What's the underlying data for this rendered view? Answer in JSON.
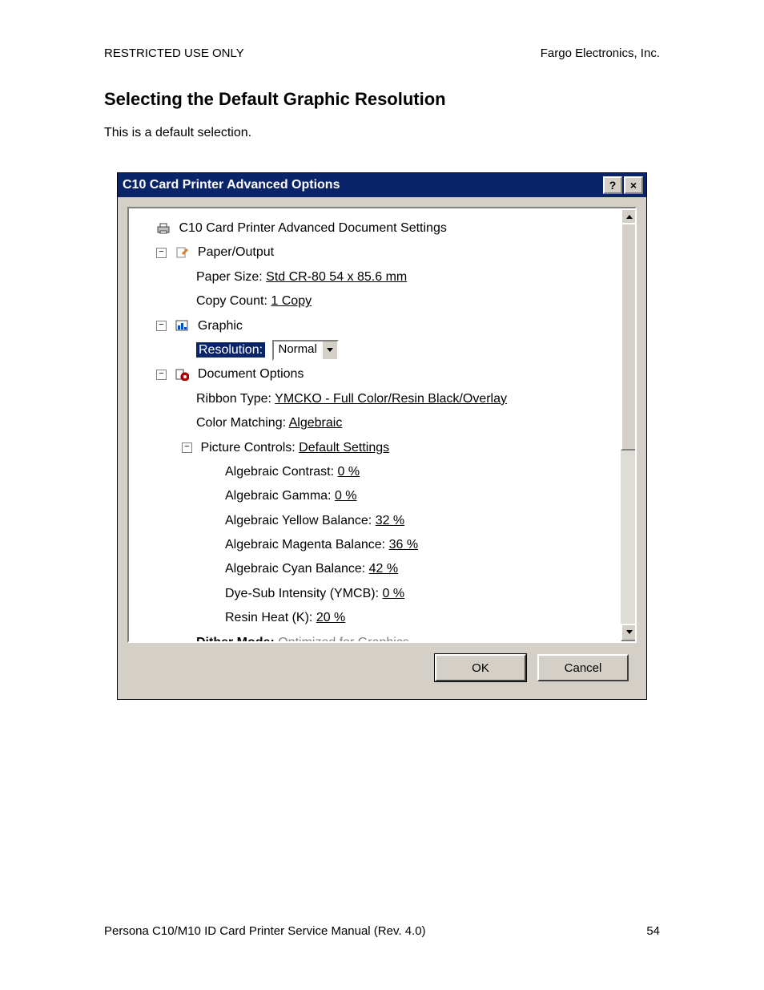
{
  "header": {
    "left": "RESTRICTED USE ONLY",
    "right": "Fargo Electronics, Inc."
  },
  "section_title": "Selecting the Default Graphic Resolution",
  "body_text": "This is a default selection.",
  "footer": {
    "left": "Persona C10/M10 ID Card Printer Service Manual (Rev. 4.0)",
    "right": "54"
  },
  "dialog": {
    "title": "C10 Card Printer Advanced Options",
    "help": "?",
    "close": "×",
    "root_label": "C10 Card Printer Advanced Document Settings",
    "paper_output": {
      "label": "Paper/Output",
      "paper_size_label": "Paper Size: ",
      "paper_size_value": "Std CR-80  54 x 85.6 mm",
      "copy_count_label": "Copy Count: ",
      "copy_count_value": "1 Copy"
    },
    "graphic": {
      "label": "Graphic",
      "resolution_label": "Resolution:",
      "resolution_value": "Normal"
    },
    "doc_options": {
      "label": "Document Options",
      "ribbon_label": "Ribbon Type: ",
      "ribbon_value": "YMCKO - Full Color/Resin Black/Overlay",
      "color_match_label": "Color Matching: ",
      "color_match_value": "Algebraic",
      "picture_controls_label": "Picture Controls: ",
      "picture_controls_value": "Default Settings",
      "contrast_label": "Algebraic Contrast: ",
      "contrast_value": "0 %",
      "gamma_label": "Algebraic Gamma: ",
      "gamma_value": "0 %",
      "yellow_label": "Algebraic Yellow Balance: ",
      "yellow_value": "32 %",
      "magenta_label": "Algebraic Magenta Balance: ",
      "magenta_value": "36 %",
      "cyan_label": "Algebraic Cyan Balance: ",
      "cyan_value": "42 %",
      "dyesub_label": "Dye-Sub Intensity (YMCB): ",
      "dyesub_value": "0 %",
      "resin_label": "Resin Heat (K): ",
      "resin_value": "20 %",
      "dither_label": "Dither Mode: ",
      "dither_value": "Optimized for Graphics"
    },
    "buttons": {
      "ok": "OK",
      "cancel": "Cancel"
    }
  }
}
